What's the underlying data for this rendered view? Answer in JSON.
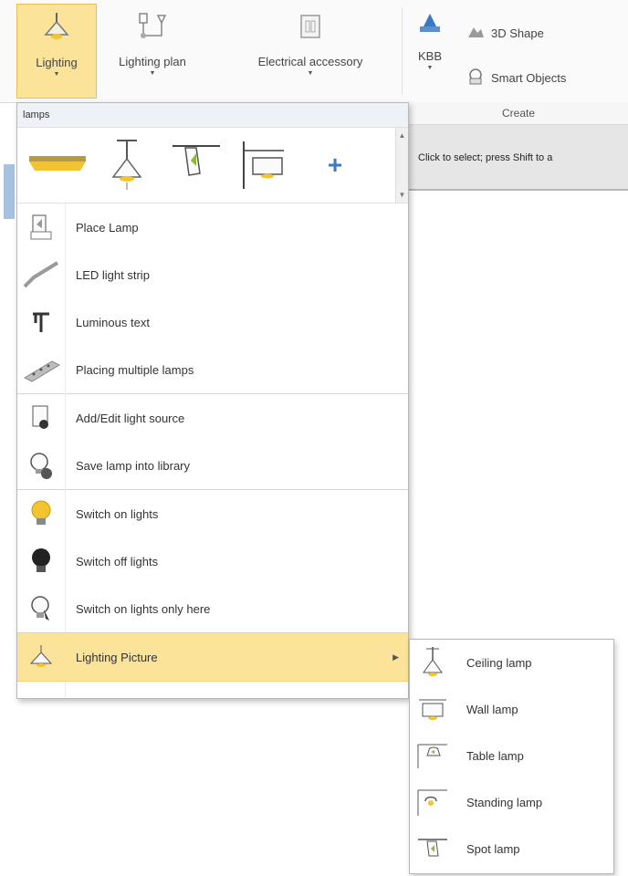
{
  "ribbon": {
    "buttons": [
      {
        "label": "Lighting",
        "icon": "ceiling-lamp-icon"
      },
      {
        "label": "Lighting plan",
        "icon": "lighting-plan-icon"
      },
      {
        "label": "Electrical accessory",
        "icon": "electrical-accessory-icon"
      }
    ],
    "kbb_label": "KBB",
    "shape_3d_label": "3D Shape",
    "smart_objects_label": "Smart Objects",
    "group_label": "Create"
  },
  "hint": "Click to select; press Shift to a",
  "dropdown": {
    "header": "lamps",
    "gallery_more": "+",
    "items": [
      {
        "label": "Place Lamp",
        "icon": "place-lamp-icon"
      },
      {
        "label": "LED light strip",
        "icon": "led-strip-icon"
      },
      {
        "label": "Luminous text",
        "icon": "luminous-text-icon"
      },
      {
        "label": "Placing multiple lamps",
        "icon": "multiple-lamps-icon"
      },
      {
        "label": "Add/Edit light source",
        "icon": "light-source-icon"
      },
      {
        "label": "Save lamp into library",
        "icon": "save-lamp-icon"
      },
      {
        "label": "Switch on lights",
        "icon": "bulb-on-icon"
      },
      {
        "label": "Switch off lights",
        "icon": "bulb-off-icon"
      },
      {
        "label": "Switch on lights only here",
        "icon": "bulb-here-icon"
      },
      {
        "label": "Lighting Picture",
        "icon": "lighting-picture-icon"
      }
    ]
  },
  "submenu": {
    "items": [
      {
        "label": "Ceiling lamp",
        "icon": "ceiling-lamp-icon"
      },
      {
        "label": "Wall lamp",
        "icon": "wall-lamp-icon"
      },
      {
        "label": "Table lamp",
        "icon": "table-lamp-icon"
      },
      {
        "label": "Standing lamp",
        "icon": "standing-lamp-icon"
      },
      {
        "label": "Spot lamp",
        "icon": "spot-lamp-icon"
      }
    ]
  },
  "colors": {
    "highlight": "#fbe39a",
    "accent_blue": "#3a78c2",
    "bulb_yellow": "#f2c530"
  }
}
